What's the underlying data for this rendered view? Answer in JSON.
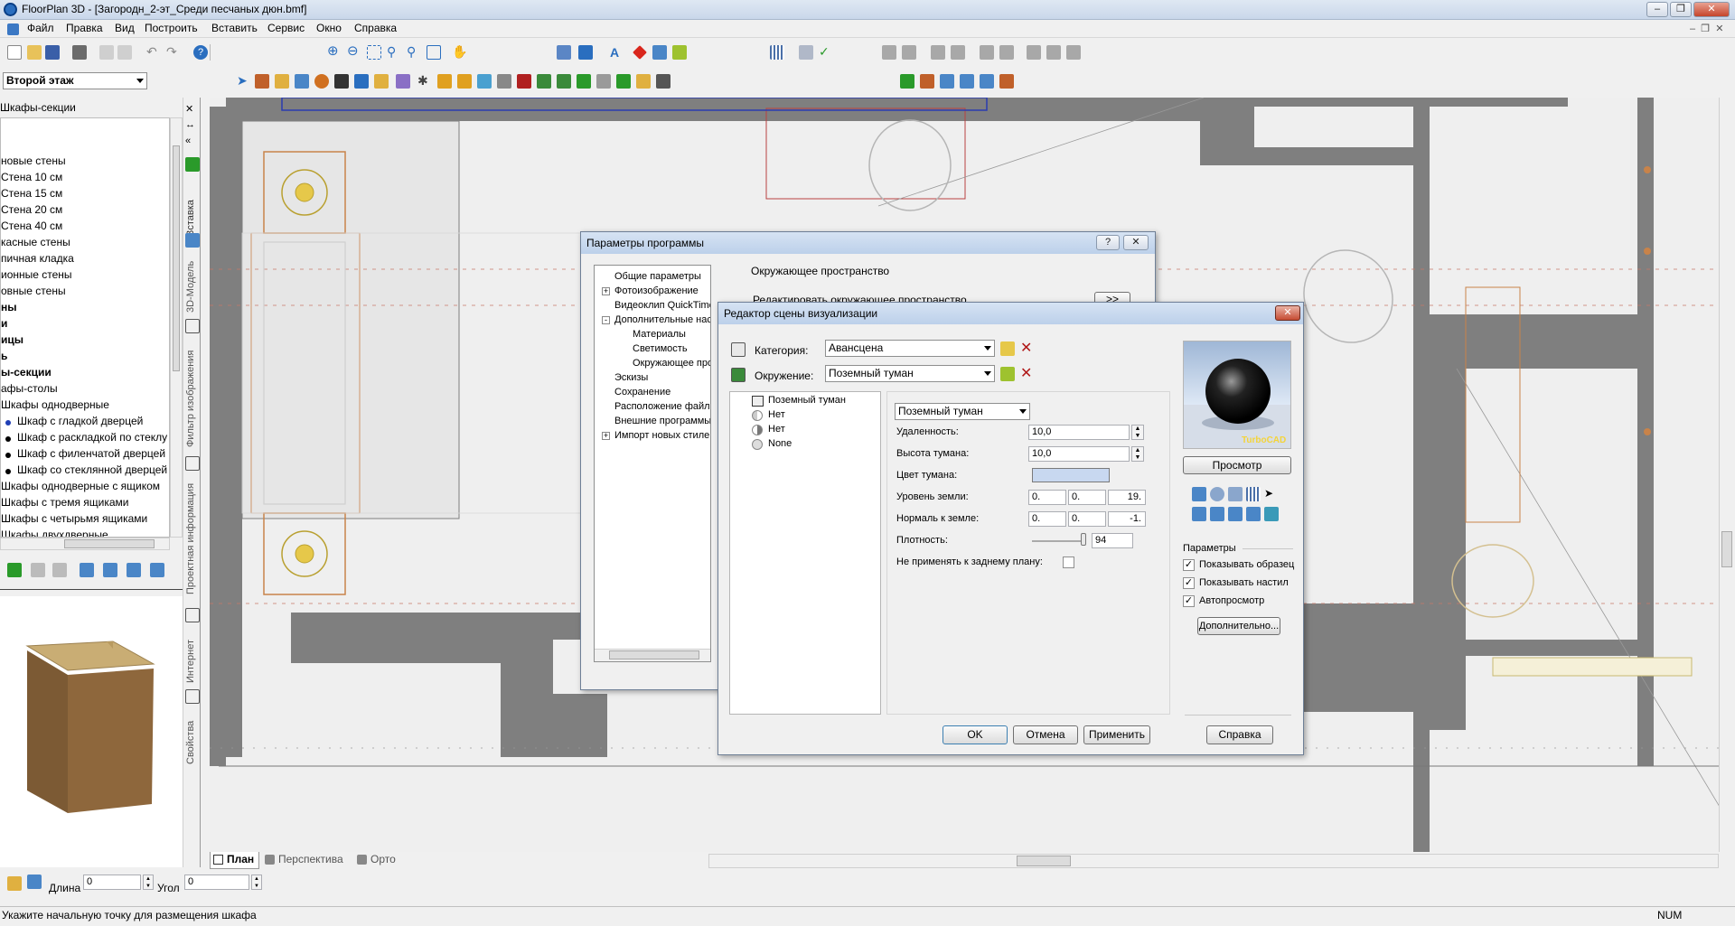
{
  "window": {
    "title": "FloorPlan 3D - [Загородн_2-эт_Среди песчаных дюн.bmf]"
  },
  "menu": [
    "Файл",
    "Правка",
    "Вид",
    "Построить",
    "Вставить",
    "Сервис",
    "Окно",
    "Справка"
  ],
  "floor_select": "Второй этаж",
  "left_panel": {
    "heading": "Шкафы-секции",
    "tree": [
      {
        "text": "новые стены",
        "bold": false
      },
      {
        "text": "Стена 10 см",
        "bold": false
      },
      {
        "text": "Стена 15 см",
        "bold": false
      },
      {
        "text": "Стена 20 см",
        "bold": false
      },
      {
        "text": "Стена 40 см",
        "bold": false
      },
      {
        "text": "касные стены",
        "bold": false
      },
      {
        "text": "пичная кладка",
        "bold": false
      },
      {
        "text": "ионные стены",
        "bold": false
      },
      {
        "text": "овные стены",
        "bold": false
      },
      {
        "text": "ны",
        "bold": true
      },
      {
        "text": "и",
        "bold": true
      },
      {
        "text": "ицы",
        "bold": true
      },
      {
        "text": "ь",
        "bold": true
      },
      {
        "text": "ы-секции",
        "bold": true
      },
      {
        "text": "афы-столы",
        "bold": false
      },
      {
        "text": "Шкафы однодверные",
        "bold": false
      },
      {
        "text": "Шкаф с гладкой дверцей",
        "bold": false,
        "selected": true
      },
      {
        "text": "Шкаф с раскладкой по стеклу",
        "bold": false
      },
      {
        "text": "Шкаф с филенчатой дверцей",
        "bold": false
      },
      {
        "text": "Шкаф со стеклянной дверцей",
        "bold": false
      },
      {
        "text": "Шкафы однодверные с ящиком",
        "bold": false
      },
      {
        "text": "Шкафы с тремя ящиками",
        "bold": false
      },
      {
        "text": "Шкафы с четырьмя ящиками",
        "bold": false
      },
      {
        "text": "Шкафы двухдверные",
        "bold": false
      }
    ],
    "side_tabs": [
      "Вставка",
      "3D-Модель",
      "Фильтр изображения",
      "Проектная информация",
      "Интернет",
      "Свойства"
    ]
  },
  "view_tabs": [
    "План",
    "Перспектива",
    "Орто"
  ],
  "bottom_inputs": {
    "length_label": "Длина",
    "length_value": "0",
    "angle_label": "Угол",
    "angle_value": "0"
  },
  "status": {
    "text": "Укажите начальную точку для размещения шкафа",
    "num": "NUM"
  },
  "program_params": {
    "title": "Параметры программы",
    "tree": [
      {
        "text": "Общие параметры",
        "indent": 0,
        "exp": ""
      },
      {
        "text": "Фотоизображение",
        "indent": 0,
        "exp": "+"
      },
      {
        "text": "Видеоклип QuickTime",
        "indent": 0,
        "exp": ""
      },
      {
        "text": "Дополнительные наст",
        "indent": 0,
        "exp": "−"
      },
      {
        "text": "Материалы",
        "indent": 1,
        "exp": ""
      },
      {
        "text": "Светимость",
        "indent": 1,
        "exp": ""
      },
      {
        "text": "Окружающее прос",
        "indent": 1,
        "exp": ""
      },
      {
        "text": "Эскизы",
        "indent": 0,
        "exp": ""
      },
      {
        "text": "Сохранение",
        "indent": 0,
        "exp": ""
      },
      {
        "text": "Расположение файлов",
        "indent": 0,
        "exp": ""
      },
      {
        "text": "Внешние программы пр",
        "indent": 0,
        "exp": ""
      },
      {
        "text": "Импорт новых стилей",
        "indent": 0,
        "exp": "+"
      }
    ],
    "section_title": "Окружающее пространство",
    "edit_label": "Редактировать окружающее пространство",
    "edit_btn": ">>"
  },
  "scene_editor": {
    "title": "Редактор сцены визуализации",
    "category_label": "Категория:",
    "category_value": "Авансцена",
    "environment_label": "Окружение:",
    "environment_value": "Поземный туман",
    "list": [
      "Поземный туман",
      "Нет",
      "Нет",
      "None"
    ],
    "type_value": "Поземный туман",
    "fields": {
      "distance_label": "Удаленность:",
      "distance_value": "10,0",
      "fog_height_label": "Высота тумана:",
      "fog_height_value": "10,0",
      "fog_color_label": "Цвет тумана:",
      "ground_level_label": "Уровень земли:",
      "ground_level_values": [
        "0.",
        "0.",
        "19."
      ],
      "normal_label": "Нормаль к земле:",
      "normal_values": [
        "0.",
        "0.",
        "-1."
      ],
      "density_label": "Плотность:",
      "density_value": "94",
      "density_level": 0.94,
      "no_bg_label": "Не применять к заднему плану:"
    },
    "preview_watermark": "TurboCAD",
    "preview_btn": "Просмотр",
    "params_label": "Параметры",
    "checks": [
      {
        "label": "Показывать образец",
        "checked": true
      },
      {
        "label": "Показывать настил",
        "checked": true
      },
      {
        "label": "Автопросмотр",
        "checked": true
      }
    ],
    "more_btn": "Дополнительно...",
    "buttons": {
      "ok": "OK",
      "cancel": "Отмена",
      "apply": "Применить",
      "help": "Справка"
    }
  },
  "colors": {
    "wall": "#7f7f7f",
    "floor": "#efefef",
    "cabinet_line": "#c8834a",
    "fog_color": "#c8d8f0",
    "accent": "#2a6ebf"
  }
}
